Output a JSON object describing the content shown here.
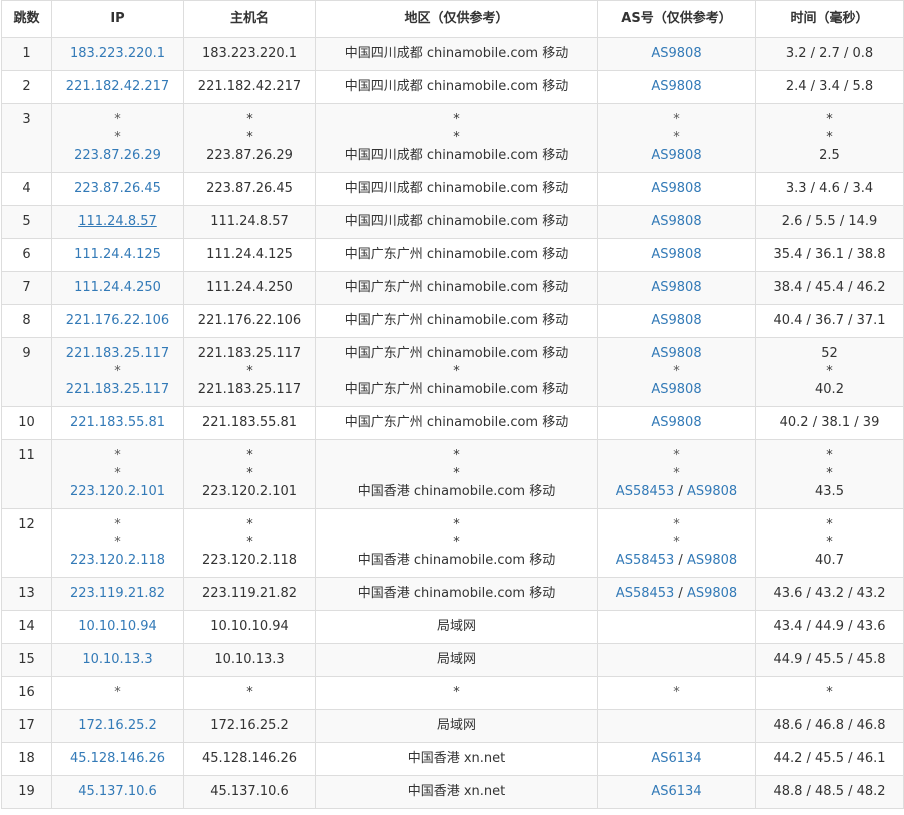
{
  "columns": [
    "跳数",
    "IP",
    "主机名",
    "地区（仅供参考）",
    "AS号（仅供参考）",
    "时间（毫秒）"
  ],
  "hops": [
    {
      "hop": "1",
      "lines": [
        {
          "ip": "183.223.220.1",
          "host": "183.223.220.1",
          "region": "中国四川成都 chinamobile.com 移动",
          "as": [
            "AS9808"
          ],
          "time": "3.2 / 2.7 / 0.8"
        }
      ]
    },
    {
      "hop": "2",
      "lines": [
        {
          "ip": "221.182.42.217",
          "host": "221.182.42.217",
          "region": "中国四川成都 chinamobile.com 移动",
          "as": [
            "AS9808"
          ],
          "time": "2.4 / 3.4 / 5.8"
        }
      ]
    },
    {
      "hop": "3",
      "lines": [
        {
          "ip": "*",
          "host": "*",
          "region": "*",
          "as": [
            "*"
          ],
          "time": "*"
        },
        {
          "ip": "*",
          "host": "*",
          "region": "*",
          "as": [
            "*"
          ],
          "time": "*"
        },
        {
          "ip": "223.87.26.29",
          "host": "223.87.26.29",
          "region": "中国四川成都 chinamobile.com 移动",
          "as": [
            "AS9808"
          ],
          "time": "2.5"
        }
      ]
    },
    {
      "hop": "4",
      "lines": [
        {
          "ip": "223.87.26.45",
          "host": "223.87.26.45",
          "region": "中国四川成都 chinamobile.com 移动",
          "as": [
            "AS9808"
          ],
          "time": "3.3 / 4.6 / 3.4"
        }
      ]
    },
    {
      "hop": "5",
      "lines": [
        {
          "ip": "111.24.8.57",
          "host": "111.24.8.57",
          "region": "中国四川成都 chinamobile.com 移动",
          "as": [
            "AS9808"
          ],
          "time": "2.6 / 5.5 / 14.9",
          "underline": true
        }
      ]
    },
    {
      "hop": "6",
      "lines": [
        {
          "ip": "111.24.4.125",
          "host": "111.24.4.125",
          "region": "中国广东广州 chinamobile.com 移动",
          "as": [
            "AS9808"
          ],
          "time": "35.4 / 36.1 / 38.8"
        }
      ]
    },
    {
      "hop": "7",
      "lines": [
        {
          "ip": "111.24.4.250",
          "host": "111.24.4.250",
          "region": "中国广东广州 chinamobile.com 移动",
          "as": [
            "AS9808"
          ],
          "time": "38.4 / 45.4 / 46.2"
        }
      ]
    },
    {
      "hop": "8",
      "lines": [
        {
          "ip": "221.176.22.106",
          "host": "221.176.22.106",
          "region": "中国广东广州 chinamobile.com 移动",
          "as": [
            "AS9808"
          ],
          "time": "40.4 / 36.7 / 37.1"
        }
      ]
    },
    {
      "hop": "9",
      "lines": [
        {
          "ip": "221.183.25.117",
          "host": "221.183.25.117",
          "region": "中国广东广州 chinamobile.com 移动",
          "as": [
            "AS9808"
          ],
          "time": "52"
        },
        {
          "ip": "*",
          "host": "*",
          "region": "*",
          "as": [
            "*"
          ],
          "time": "*"
        },
        {
          "ip": "221.183.25.117",
          "host": "221.183.25.117",
          "region": "中国广东广州 chinamobile.com 移动",
          "as": [
            "AS9808"
          ],
          "time": "40.2"
        }
      ]
    },
    {
      "hop": "10",
      "lines": [
        {
          "ip": "221.183.55.81",
          "host": "221.183.55.81",
          "region": "中国广东广州 chinamobile.com 移动",
          "as": [
            "AS9808"
          ],
          "time": "40.2 / 38.1 / 39"
        }
      ]
    },
    {
      "hop": "11",
      "lines": [
        {
          "ip": "*",
          "host": "*",
          "region": "*",
          "as": [
            "*"
          ],
          "time": "*"
        },
        {
          "ip": "*",
          "host": "*",
          "region": "*",
          "as": [
            "*"
          ],
          "time": "*"
        },
        {
          "ip": "223.120.2.101",
          "host": "223.120.2.101",
          "region": "中国香港 chinamobile.com 移动",
          "as": [
            "AS58453",
            "AS9808"
          ],
          "time": "43.5"
        }
      ]
    },
    {
      "hop": "12",
      "lines": [
        {
          "ip": "*",
          "host": "*",
          "region": "*",
          "as": [
            "*"
          ],
          "time": "*"
        },
        {
          "ip": "*",
          "host": "*",
          "region": "*",
          "as": [
            "*"
          ],
          "time": "*"
        },
        {
          "ip": "223.120.2.118",
          "host": "223.120.2.118",
          "region": "中国香港 chinamobile.com 移动",
          "as": [
            "AS58453",
            "AS9808"
          ],
          "time": "40.7"
        }
      ]
    },
    {
      "hop": "13",
      "lines": [
        {
          "ip": "223.119.21.82",
          "host": "223.119.21.82",
          "region": "中国香港 chinamobile.com 移动",
          "as": [
            "AS58453",
            "AS9808"
          ],
          "time": "43.6 / 43.2 / 43.2"
        }
      ]
    },
    {
      "hop": "14",
      "lines": [
        {
          "ip": "10.10.10.94",
          "host": "10.10.10.94",
          "region": "局域网",
          "as": [],
          "time": "43.4 / 44.9 / 43.6"
        }
      ]
    },
    {
      "hop": "15",
      "lines": [
        {
          "ip": "10.10.13.3",
          "host": "10.10.13.3",
          "region": "局域网",
          "as": [],
          "time": "44.9 / 45.5 / 45.8"
        }
      ]
    },
    {
      "hop": "16",
      "lines": [
        {
          "ip": "*",
          "host": "*",
          "region": "*",
          "as": [
            "*"
          ],
          "time": "*"
        }
      ]
    },
    {
      "hop": "17",
      "lines": [
        {
          "ip": "172.16.25.2",
          "host": "172.16.25.2",
          "region": "局域网",
          "as": [],
          "time": "48.6 / 46.8 / 46.8"
        }
      ]
    },
    {
      "hop": "18",
      "lines": [
        {
          "ip": "45.128.146.26",
          "host": "45.128.146.26",
          "region": "中国香港 xn.net",
          "as": [
            "AS6134"
          ],
          "time": "44.2 / 45.5 / 46.1"
        }
      ]
    },
    {
      "hop": "19",
      "lines": [
        {
          "ip": "45.137.10.6",
          "host": "45.137.10.6",
          "region": "中国香港 xn.net",
          "as": [
            "AS6134"
          ],
          "time": "48.8 / 48.5 / 48.2"
        }
      ]
    }
  ],
  "colors": {
    "link": "#337ab7",
    "border": "#dddddd",
    "stripe": "#f9f9f9",
    "text": "#333333"
  }
}
